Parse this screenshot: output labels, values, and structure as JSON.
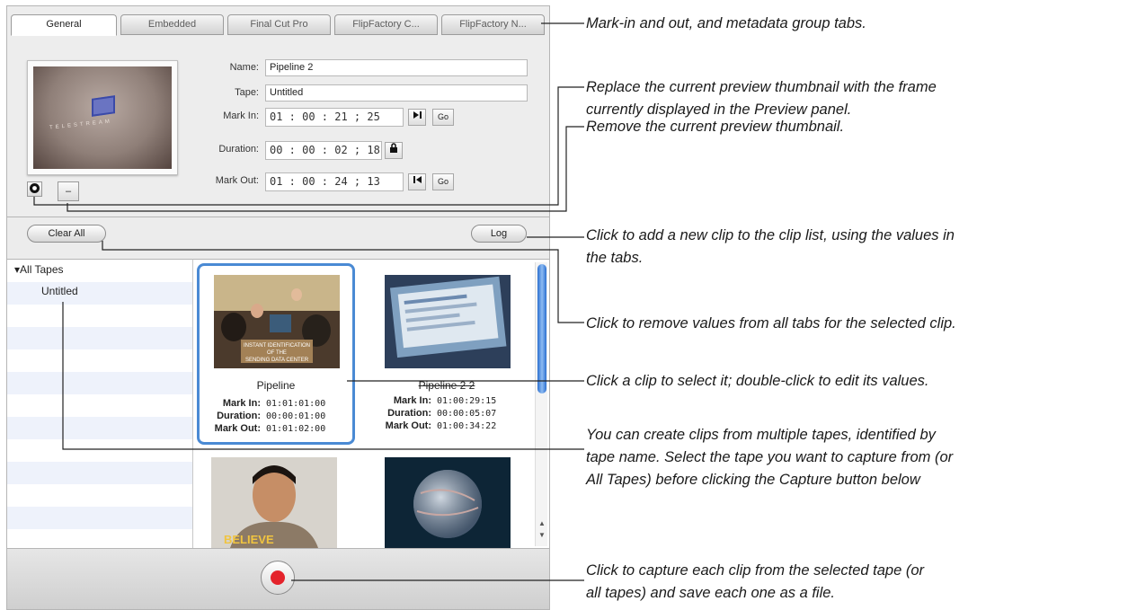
{
  "tabs": [
    {
      "label": "General",
      "active": true
    },
    {
      "label": "Embedded",
      "active": false
    },
    {
      "label": "Final Cut Pro",
      "active": false
    },
    {
      "label": "FlipFactory C...",
      "active": false
    },
    {
      "label": "FlipFactory N...",
      "active": false
    }
  ],
  "thumbnail": {
    "logo_text": "TELESTREAM",
    "set_button_icon": "capture-frame-icon",
    "clear_button_icon": "minus-icon",
    "clear_button_symbol": "–"
  },
  "fields": {
    "name_label": "Name:",
    "name_value": "Pipeline 2",
    "tape_label": "Tape:",
    "tape_value": "Untitled",
    "mark_in_label": "Mark In:",
    "mark_in_value": "01 : 00 : 21 ; 25",
    "duration_label": "Duration:",
    "duration_value": "00 : 00 : 02 ; 18",
    "mark_out_label": "Mark Out:",
    "mark_out_value": "01 : 00 : 24 ; 13",
    "go_label": "Go",
    "mark_in_icon": "play-to-end-icon",
    "lock_icon": "lock-icon",
    "mark_out_icon": "back-to-start-icon"
  },
  "buttons": {
    "clear_all": "Clear All",
    "log": "Log",
    "capture_icon": "record-icon"
  },
  "tape_list": {
    "root": "▾All Tapes",
    "items": [
      "Untitled"
    ]
  },
  "clips": [
    {
      "name": "Pipeline",
      "mark_in_label": "Mark In:",
      "mark_in": "01:01:01:00",
      "duration_label": "Duration:",
      "duration": "00:00:01:00",
      "mark_out_label": "Mark Out:",
      "mark_out": "01:01:02:00",
      "caption_lines": [
        "INSTANT IDENTIFICATION",
        "OF THE",
        "SENDING DATA CENTER"
      ],
      "selected": true
    },
    {
      "name": "Pipeline 2 2",
      "mark_in_label": "Mark In:",
      "mark_in": "01:00:29:15",
      "duration_label": "Duration:",
      "duration": "00:00:05:07",
      "mark_out_label": "Mark Out:",
      "mark_out": "01:00:34:22",
      "selected": false
    },
    {
      "name": "",
      "caption": "BELIEVE"
    },
    {
      "name": ""
    }
  ],
  "scroll": {
    "up": "▲",
    "down": "▼"
  },
  "annotations": {
    "tabs": "Mark-in and out, and metadata group tabs.",
    "replace_thumb_1": "Replace the current preview thumbnail with the frame",
    "replace_thumb_2": "currently displayed in the Preview panel.",
    "remove_thumb": "Remove the current preview thumbnail.",
    "log_1": "Click to add a new clip to the clip list, using the values in",
    "log_2": "the tabs.",
    "clear_all": "Click to remove values from all tabs for the selected clip.",
    "select_clip": "Click a clip to select it; double-click to edit its values.",
    "tapes_1": "You can create clips from multiple tapes, identified by",
    "tapes_2": "tape name. Select the tape you want to capture from (or",
    "tapes_3": "All Tapes) before clicking the Capture button below",
    "capture_1": "Click to capture each clip from the selected tape (or",
    "capture_2": "all tapes) and save each one as a file."
  }
}
